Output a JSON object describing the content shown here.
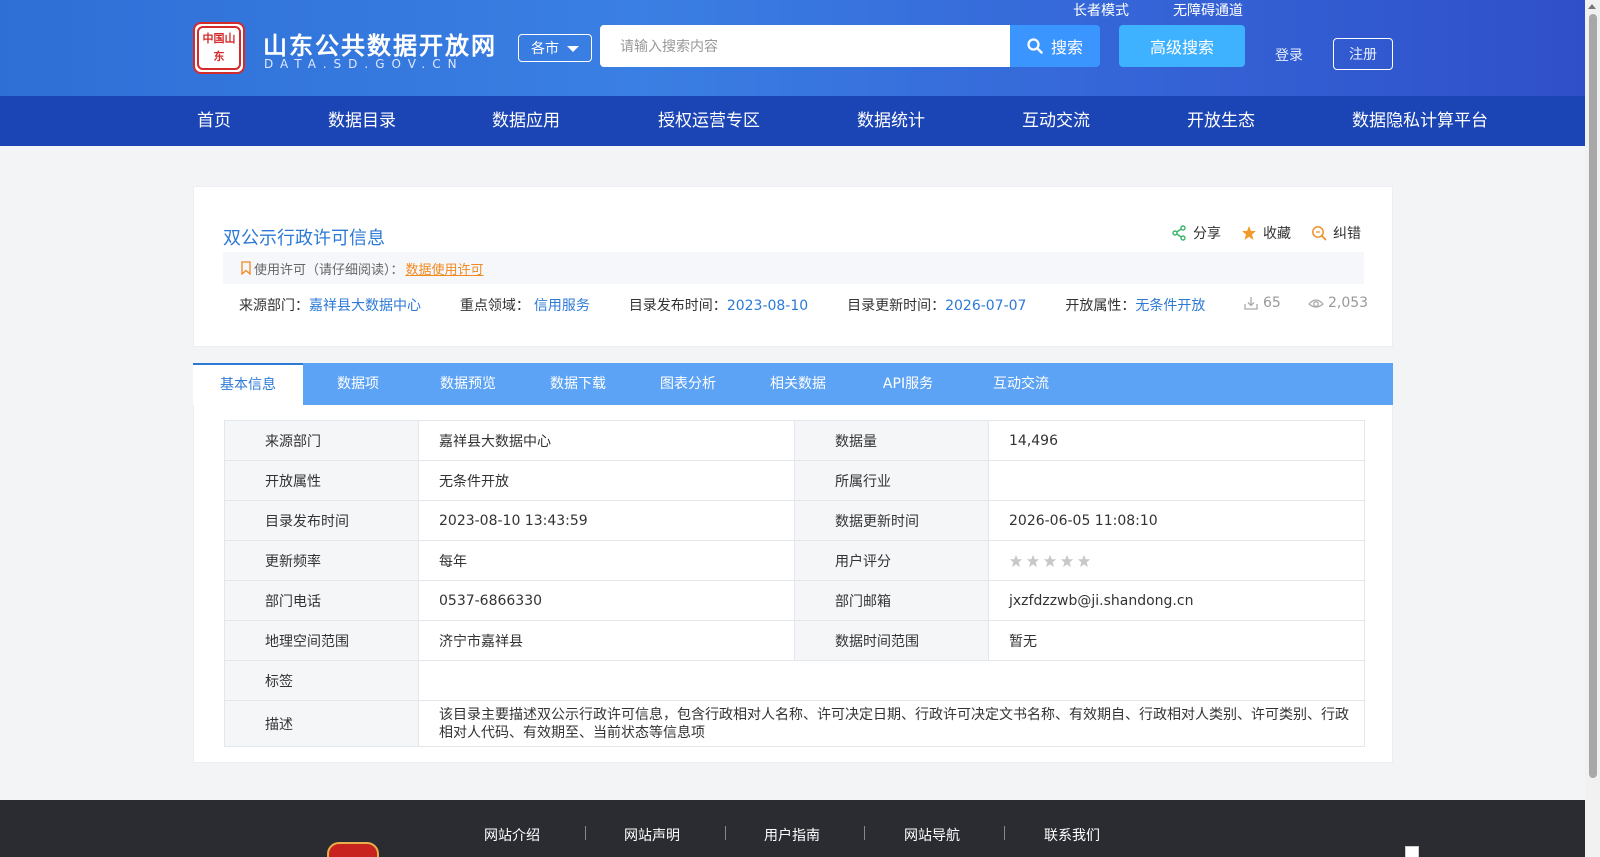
{
  "header": {
    "logo_seal_text": "中国山东",
    "site_title": "山东公共数据开放网",
    "site_domain": "DATA.SD.GOV.CN",
    "city_select": "各市",
    "search_placeholder": "请输入搜索内容",
    "search_button": "搜索",
    "advanced_search": "高级搜索",
    "elder_mode": "长者模式",
    "accessibility": "无障碍通道",
    "login": "登录",
    "register": "注册"
  },
  "nav": [
    "首页",
    "数据目录",
    "数据应用",
    "授权运营专区",
    "数据统计",
    "互动交流",
    "开放生态",
    "数据隐私计算平台"
  ],
  "dataset": {
    "title": "双公示行政许可信息",
    "actions": {
      "share": "分享",
      "favorite": "收藏",
      "report": "纠错"
    },
    "license_label": "使用许可（请仔细阅读）：",
    "license_link": "数据使用许可",
    "meta": {
      "source_label": "来源部门：",
      "source_value": "嘉祥县大数据中心",
      "domain_label": "重点领域：",
      "domain_value": "信用服务",
      "publish_label": "目录发布时间：",
      "publish_value": "2023-08-10",
      "update_label": "目录更新时间：",
      "update_value": "2026-07-07",
      "open_label": "开放属性：",
      "open_value": "无条件开放"
    },
    "downloads": "65",
    "views": "2,053"
  },
  "tabs": [
    "基本信息",
    "数据项",
    "数据预览",
    "数据下载",
    "图表分析",
    "相关数据",
    "API服务",
    "互动交流"
  ],
  "info": {
    "source_dept_k": "来源部门",
    "source_dept_v": "嘉祥县大数据中心",
    "data_volume_k": "数据量",
    "data_volume_v": "14,496",
    "open_attr_k": "开放属性",
    "open_attr_v": "无条件开放",
    "industry_k": "所属行业",
    "industry_v": "",
    "publish_time_k": "目录发布时间",
    "publish_time_v": "2023-08-10 13:43:59",
    "update_time_k": "数据更新时间",
    "update_time_v": "2026-06-05 11:08:10",
    "frequency_k": "更新频率",
    "frequency_v": "每年",
    "rating_k": "用户评分",
    "rating_value": 0,
    "rating_max": 5,
    "phone_k": "部门电话",
    "phone_v": "0537-6866330",
    "email_k": "部门邮箱",
    "email_v": "jxzfdzzwb@ji.shandong.cn",
    "geo_k": "地理空间范围",
    "geo_v": "济宁市嘉祥县",
    "time_range_k": "数据时间范围",
    "time_range_v": "暂无",
    "tags_k": "标签",
    "tags_v": "",
    "desc_k": "描述",
    "desc_v": "该目录主要描述双公示行政许可信息，包含行政相对人名称、许可决定日期、行政许可决定文书名称、有效期自、行政相对人类别、许可类别、行政相对人代码、有效期至、当前状态等信息项"
  },
  "footer": [
    "网站介绍",
    "网站声明",
    "用户指南",
    "网站导航",
    "联系我们"
  ],
  "colors": {
    "header_blue": "#2e6fd6",
    "nav_blue": "#1b44b5",
    "tab_blue": "#5da3f5",
    "link_blue": "#2d7ad6",
    "license_orange": "#f28a1e"
  }
}
